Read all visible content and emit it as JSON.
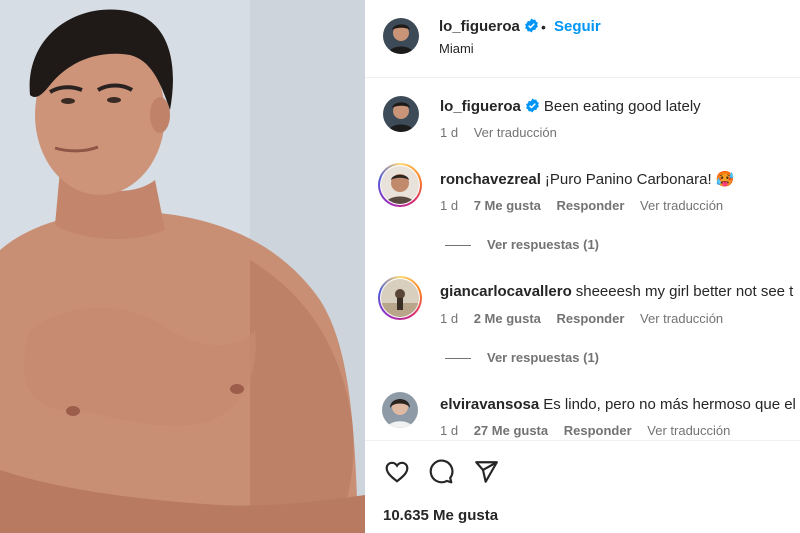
{
  "post": {
    "username": "lo_figueroa",
    "separator": "•",
    "follow_label": "Seguir",
    "location": "Miami"
  },
  "caption": {
    "username": "lo_figueroa",
    "text": "Been eating good lately",
    "age": "1 d",
    "translate_label": "Ver traducción"
  },
  "comments": [
    {
      "username": "ronchavezreal",
      "text": "¡Puro Panino Carbonara! 🥵",
      "age": "1 d",
      "likes": "7 Me gusta",
      "reply_label": "Responder",
      "translate_label": "Ver traducción",
      "replies_label": "Ver respuestas (1)"
    },
    {
      "username": "giancarlocavallero",
      "text": "sheeeesh my girl better not see t",
      "age": "1 d",
      "likes": "2 Me gusta",
      "reply_label": "Responder",
      "translate_label": "Ver traducción",
      "replies_label": "Ver respuestas (1)"
    },
    {
      "username": "elviravansosa",
      "text": "Es lindo, pero no más hermoso que el",
      "age": "1 d",
      "likes": "27 Me gusta",
      "reply_label": "Responder",
      "translate_label": "Ver traducción"
    }
  ],
  "footer": {
    "likes_count": "10.635 Me gusta"
  },
  "icons": {
    "like": "heart-icon",
    "comment": "comment-icon",
    "share": "share-icon",
    "verified": "verified-badge-icon"
  },
  "colors": {
    "accent": "#0095f6",
    "verified": "#0095f6",
    "muted": "#737373"
  }
}
